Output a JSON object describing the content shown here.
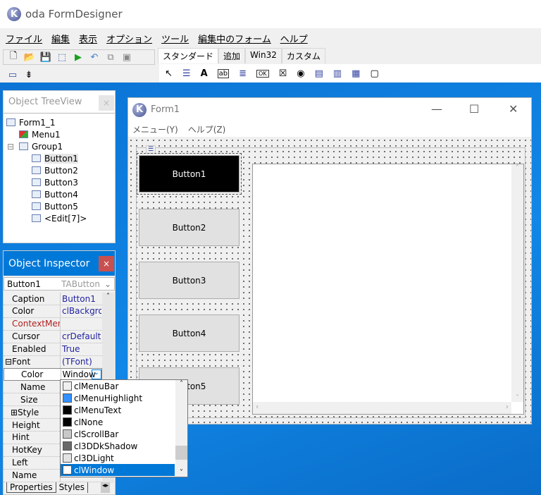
{
  "app": {
    "title": "oda FormDesigner",
    "menu": [
      "ファイル",
      "編集",
      "表示",
      "オプション",
      "ツール",
      "編集中のフォーム",
      "ヘルプ"
    ],
    "toolbar_icons": [
      "new-icon",
      "open-icon",
      "save-icon",
      "select-form-icon",
      "run-icon",
      "undo-icon",
      "copy-icon",
      "paste-icon"
    ],
    "palette_tabs": [
      "スタンダード",
      "追加",
      "Win32",
      "カスタム"
    ],
    "active_palette_tab": "スタンダード",
    "palette_icons": [
      "pointer-icon",
      "menu-icon",
      "label-icon",
      "edit-icon",
      "memo-icon",
      "button-icon",
      "checkbox-icon",
      "radiobutton-icon",
      "listbox-icon",
      "combobox-icon",
      "scrollbar-icon",
      "groupbox-icon"
    ]
  },
  "tree": {
    "title": "Object TreeView",
    "close": "×",
    "nodes": [
      {
        "label": "Form1_1",
        "level": 0
      },
      {
        "label": "Menu1",
        "level": 1
      },
      {
        "label": "Group1",
        "level": 1
      },
      {
        "label": "Button1",
        "level": 2,
        "selected": true
      },
      {
        "label": "Button2",
        "level": 2
      },
      {
        "label": "Button3",
        "level": 2
      },
      {
        "label": "Button4",
        "level": 2
      },
      {
        "label": "Button5",
        "level": 2
      },
      {
        "label": "<Edit[7]>",
        "level": 2
      }
    ]
  },
  "inspector": {
    "title": "Object Inspector",
    "close": "×",
    "object": "Button1",
    "object_type": "TAButton",
    "rows": [
      {
        "key": "Caption",
        "value": "Button1"
      },
      {
        "key": "Color",
        "value": "clBackgro"
      },
      {
        "key": "ContextMen",
        "value": "",
        "highlight": true
      },
      {
        "key": "Cursor",
        "value": "crDefault"
      },
      {
        "key": "Enabled",
        "value": "True"
      },
      {
        "key": "⊟Font",
        "value": "(TFont)"
      },
      {
        "key": "Color",
        "value": "Window",
        "editing": true
      },
      {
        "key": "Name",
        "value": ""
      },
      {
        "key": "Size",
        "value": ""
      },
      {
        "key": "⊞Style",
        "value": ""
      },
      {
        "key": "Height",
        "value": ""
      },
      {
        "key": "Hint",
        "value": ""
      },
      {
        "key": "HotKey",
        "value": ""
      },
      {
        "key": "Left",
        "value": ""
      },
      {
        "key": "Name",
        "value": ""
      }
    ],
    "tabs": [
      "Properties",
      "Styles"
    ]
  },
  "dropdown": {
    "options": [
      {
        "label": "clMenuBar",
        "color": "#f0f0f0"
      },
      {
        "label": "clMenuHighlight",
        "color": "#3390ff"
      },
      {
        "label": "clMenuText",
        "color": "#000000"
      },
      {
        "label": "clNone",
        "color": "#000000"
      },
      {
        "label": "clScrollBar",
        "color": "#c8c8c8"
      },
      {
        "label": "cl3DDkShadow",
        "color": "#696969"
      },
      {
        "label": "cl3DLight",
        "color": "#e3e3e3"
      },
      {
        "label": "clWindow",
        "color": "#ffffff",
        "selected": true
      }
    ]
  },
  "form": {
    "title": "Form1",
    "menu": [
      "メニュー(Y)",
      "ヘルプ(Z)"
    ],
    "buttons": [
      "Button1",
      "Button2",
      "Button3",
      "Button4",
      "Button5"
    ],
    "selected_button": "Button1",
    "selected_button_color": "#000000"
  }
}
